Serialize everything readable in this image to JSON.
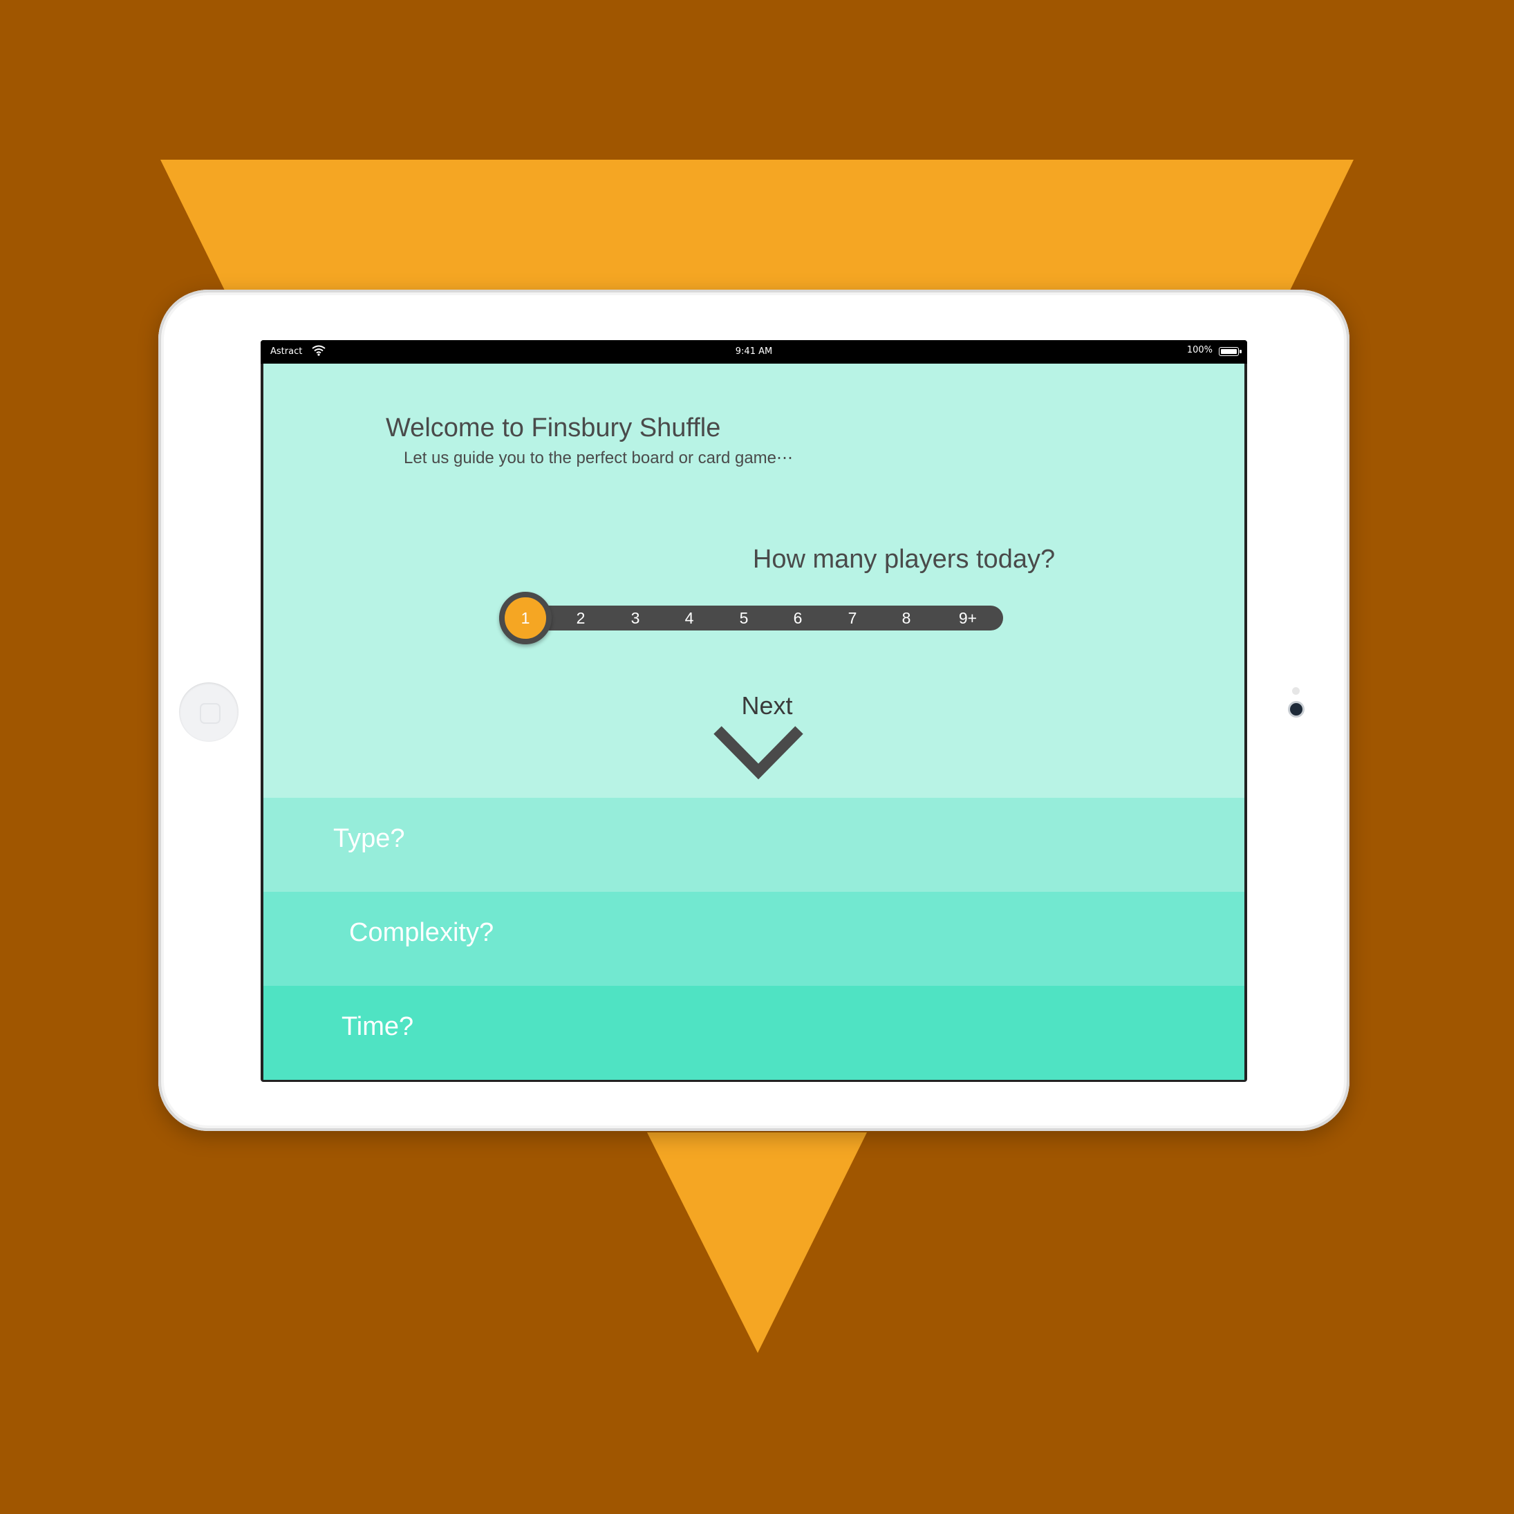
{
  "colors": {
    "background": "#A05600",
    "triangle": "#F5A623",
    "app_background": "#B8F3E5",
    "accent": "#F5A623",
    "slider_track": "#4a4a4a",
    "row_type": "#96EDDA",
    "row_complexity": "#72E8D0",
    "row_time": "#4FE3C3"
  },
  "status_bar": {
    "carrier": "Astract",
    "wifi_icon": "wifi-icon",
    "time": "9:41 AM",
    "battery": "100%"
  },
  "welcome": {
    "title": "Welcome to Finsbury Shuffle",
    "subtitle": "Let us guide you to the perfect board or card game⋯"
  },
  "players": {
    "question": "How many players today?",
    "options": [
      "1",
      "2",
      "3",
      "4",
      "5",
      "6",
      "7",
      "8",
      "9+"
    ],
    "selected": "1"
  },
  "next": {
    "label": "Next",
    "icon": "chevron-down-icon"
  },
  "filters": [
    {
      "label": "Type?"
    },
    {
      "label": "Complexity?"
    },
    {
      "label": "Time?"
    }
  ]
}
